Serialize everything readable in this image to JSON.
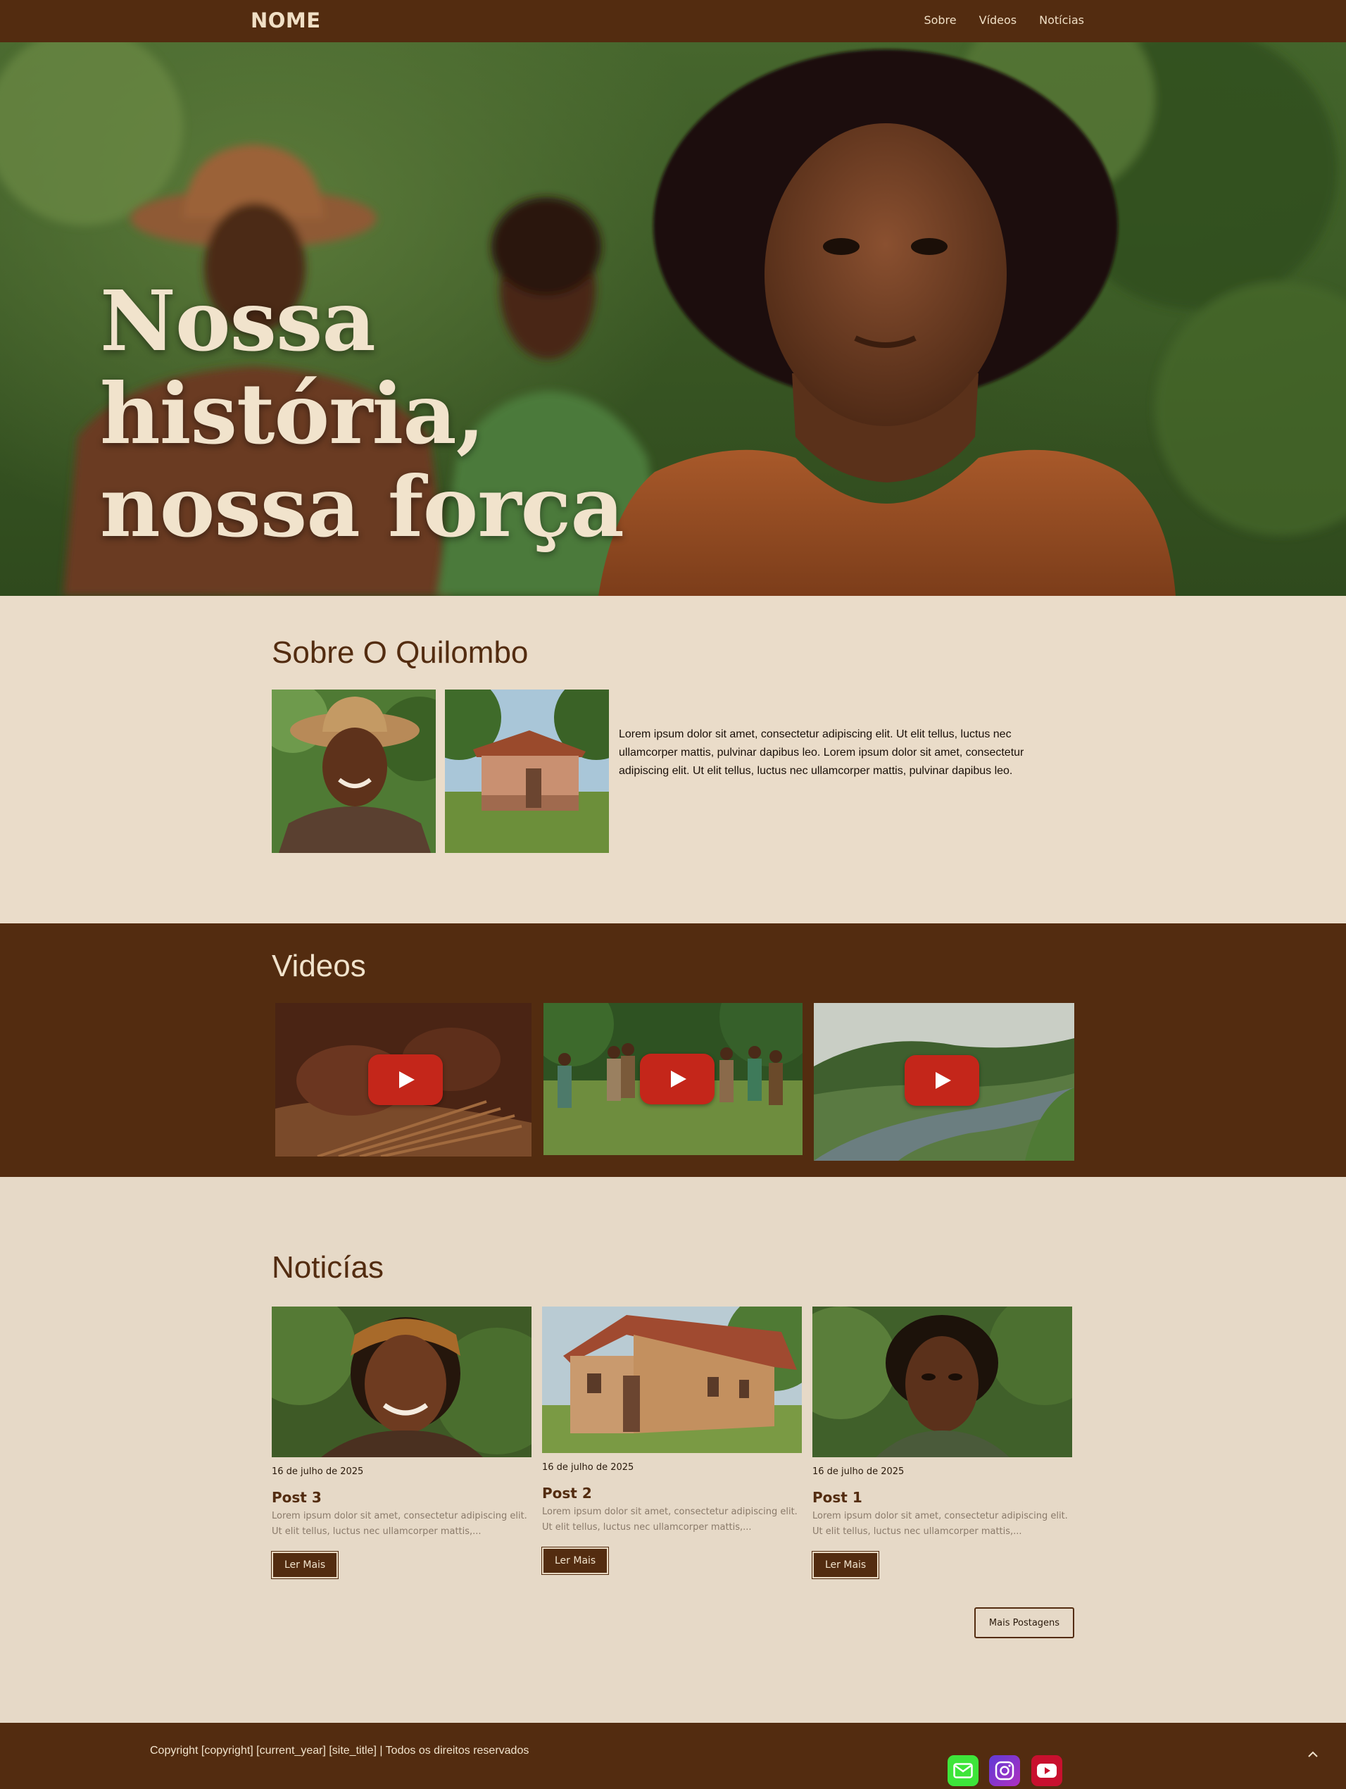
{
  "header": {
    "logo": "NOME",
    "nav": [
      {
        "label": "Sobre"
      },
      {
        "label": "Vídeos"
      },
      {
        "label": "Notícias"
      }
    ]
  },
  "hero": {
    "title_line1": "Nossa história,",
    "title_line2": "nossa força"
  },
  "about": {
    "title": "Sobre O Quilombo",
    "text": "Lorem ipsum dolor sit amet, consectetur adipiscing elit. Ut elit tellus, luctus nec ullamcorper mattis, pulvinar dapibus leo. Lorem ipsum dolor sit amet, consectetur adipiscing elit. Ut elit tellus, luctus nec ullamcorper mattis, pulvinar dapibus leo."
  },
  "videos": {
    "title": "Videos",
    "items": [
      {
        "icon": "play-icon"
      },
      {
        "icon": "play-icon"
      },
      {
        "icon": "play-icon"
      }
    ]
  },
  "news": {
    "title": "Noticías",
    "posts": [
      {
        "date": "16 de julho de 2025",
        "title": "Post 3",
        "excerpt": "Lorem ipsum dolor sit amet, consectetur adipiscing elit. Ut elit tellus, luctus nec ullamcorper mattis,...",
        "button": "Ler Mais"
      },
      {
        "date": "16 de julho de 2025",
        "title": "Post 2",
        "excerpt": "Lorem ipsum dolor sit amet, consectetur adipiscing elit. Ut elit tellus, luctus nec ullamcorper mattis,...",
        "button": "Ler Mais"
      },
      {
        "date": "16 de julho de 2025",
        "title": "Post 1",
        "excerpt": "Lorem ipsum dolor sit amet, consectetur adipiscing elit. Ut elit tellus, luctus nec ullamcorper mattis,...",
        "button": "Ler Mais"
      }
    ],
    "more_button": "Mais Postagens"
  },
  "footer": {
    "copyright": "Copyright [copyright] [current_year] [site_title] | Todos os direitos reservados",
    "social": [
      {
        "icon": "email-icon",
        "color": "#3ee53a"
      },
      {
        "icon": "instagram-icon",
        "color": "#8a36c8"
      },
      {
        "icon": "youtube-icon",
        "color": "#c8102e"
      }
    ]
  },
  "colors": {
    "brand_brown": "#532c10",
    "page_beige": "#e6d9c7",
    "cream_text": "#f1e3cc",
    "play_red": "#c4261a"
  }
}
